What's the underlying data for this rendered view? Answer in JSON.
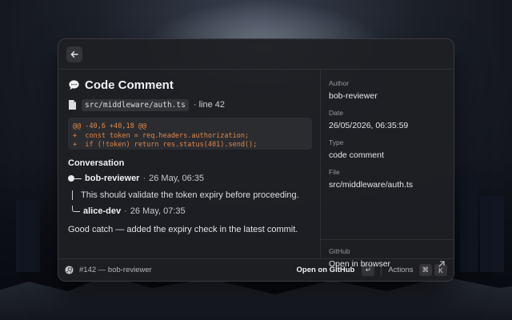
{
  "window": {
    "title": "Code Comment",
    "back_icon": "arrow-left-icon"
  },
  "comment": {
    "file_path": "src/middleware/auth.ts",
    "line_ref": "· line 42",
    "diff_lines": [
      "@@ -40,6 +40,18 @@",
      "+  const token = req.headers.authorization;",
      "+  if (!token) return res.status(401).send();"
    ],
    "conversation_heading": "Conversation",
    "thread": {
      "author": "bob-reviewer",
      "time": "26 May, 06:35",
      "body": "This should validate the token expiry before proceeding."
    },
    "reply": {
      "author": "alice-dev",
      "time": "26 May, 07:35",
      "body": "Good catch — added the expiry check in the latest commit."
    },
    "separator": "·"
  },
  "sidebar": {
    "fields": [
      {
        "label": "Author",
        "value": "bob-reviewer"
      },
      {
        "label": "Date",
        "value": "26/05/2026, 06:35:59"
      },
      {
        "label": "Type",
        "value": "code comment"
      },
      {
        "label": "File",
        "value": "src/middleware/auth.ts"
      }
    ],
    "github_label": "GitHub",
    "github_link": "Open in browser"
  },
  "footer": {
    "title": "#142 — bob-reviewer",
    "primary_action": "Open on GitHub",
    "primary_key": "↵",
    "actions_label": "Actions",
    "actions_keys": [
      "⌘",
      "K"
    ]
  },
  "colors": {
    "diff_text": "#e0874a",
    "window_bg": "#1e1f23"
  }
}
